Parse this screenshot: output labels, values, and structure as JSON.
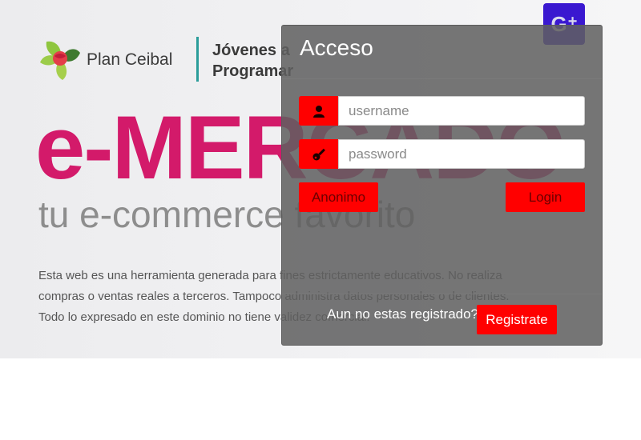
{
  "brand": {
    "name": "Plan Ceibal",
    "program_line1": "Jóvenes a",
    "program_line2": "Programar"
  },
  "hero": {
    "title": "e-MERCADO",
    "tagline": "tu e-commerce favorito",
    "disclaimer": "Esta web es una herramienta generada para fines estrictamente educativos. No realiza compras o ventas reales a terceros. Tampoco administra datos personales o de clientes. Todo lo expresado en este dominio no tiene validez comercial."
  },
  "social": {
    "gplus_label": "G",
    "gplus_plus": "+"
  },
  "login": {
    "title": "Acceso",
    "username_placeholder": "username",
    "username_value": "",
    "password_placeholder": "password",
    "password_value": "",
    "user_icon": "user-icon",
    "key_icon": "key-icon",
    "anon_label": "Anonimo",
    "login_label": "Login",
    "register_prompt": "Aun no estas registrado?",
    "register_label": "Registrate"
  },
  "colors": {
    "accent_red": "#ff0000",
    "title_magenta": "#d31a6a",
    "gplus_purple": "#3a18d0",
    "teal_divider": "#2a9d9a"
  }
}
